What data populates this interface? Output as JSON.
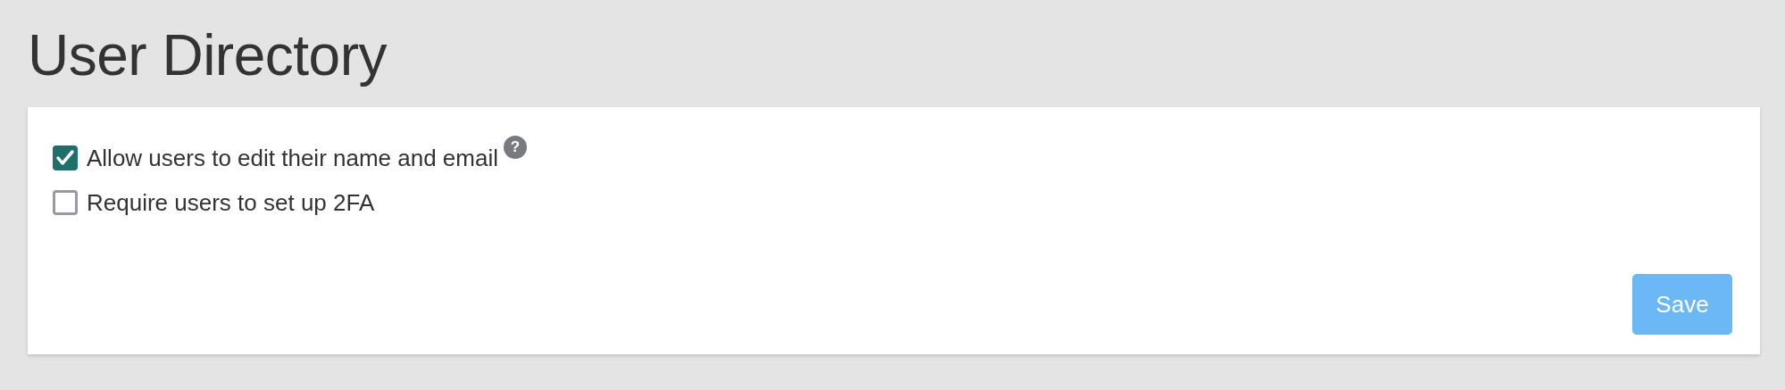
{
  "title": "User Directory",
  "options": [
    {
      "label": "Allow users to edit their name and email",
      "checked": true,
      "help": "?"
    },
    {
      "label": "Require users to set up 2FA",
      "checked": false
    }
  ],
  "save_button": {
    "label": "Save",
    "disabled": true
  }
}
